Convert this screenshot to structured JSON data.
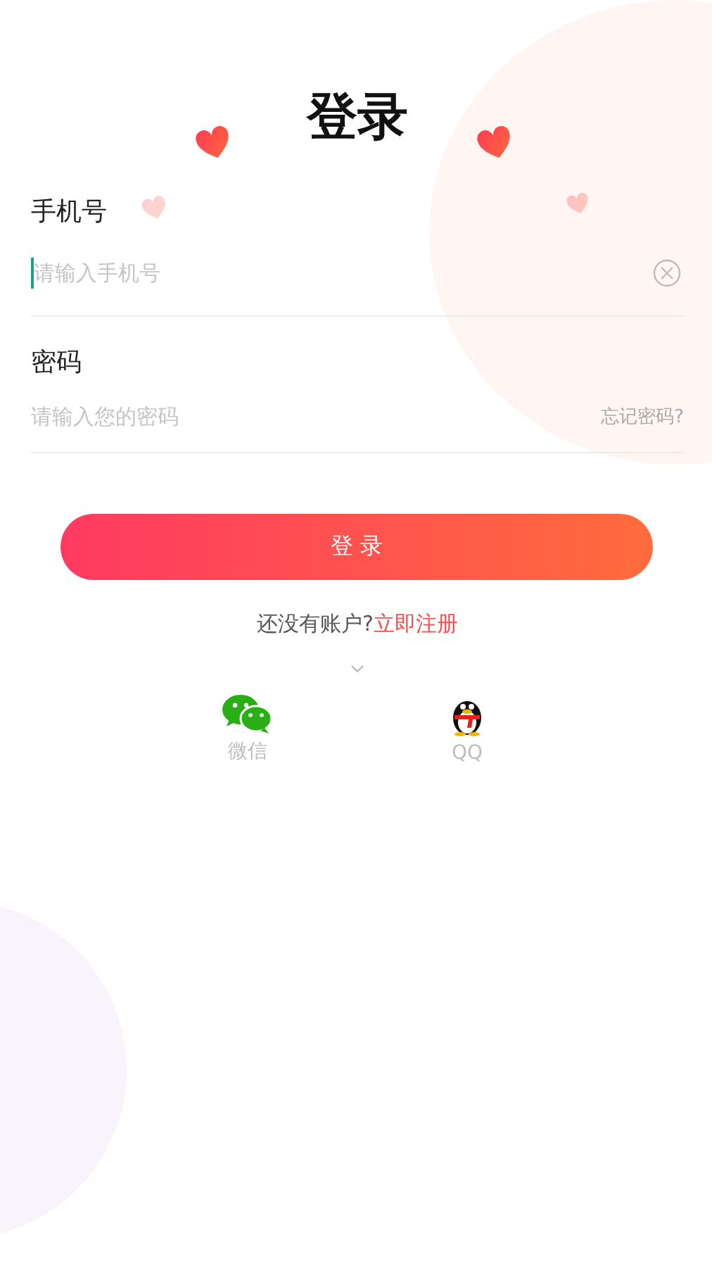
{
  "title": "登录",
  "phone": {
    "label": "手机号",
    "placeholder": "请输入手机号",
    "focused": true
  },
  "password": {
    "label": "密码",
    "placeholder": "请输入您的密码",
    "forgot": "忘记密码?"
  },
  "login_button": "登 录",
  "register": {
    "prompt": "还没有账户?",
    "link": "立即注册"
  },
  "social": [
    {
      "kind": "wechat",
      "label": "微信"
    },
    {
      "kind": "qq",
      "label": "QQ"
    }
  ]
}
